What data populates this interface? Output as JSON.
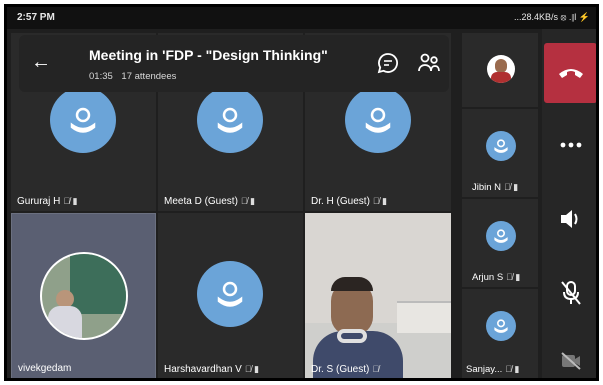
{
  "status_bar": {
    "time": "2:57 PM",
    "network": "...28.4KB/s ⦻ .∥l ⚡"
  },
  "header": {
    "title": "Meeting in 'FDP - \"Design Thinking\"",
    "duration": "01:35",
    "attendees": "17 attendees"
  },
  "participants": {
    "gururaj": "Gururaj H",
    "meeta": "Meeta D (Guest)",
    "drh": "Dr. H (Guest)",
    "jibin": "Jibin N",
    "arjun": "Arjun S",
    "sanjay": "Sanjay...",
    "vivek": "vivekgedam",
    "harsha": "Harshavardhan V",
    "drs": "Dr. S (Guest)"
  },
  "icons": {
    "mic_muted": "🎙̸",
    "cam_off": "▮"
  },
  "colors": {
    "avatar": "#6ba4d8",
    "end_call": "#b53040"
  }
}
